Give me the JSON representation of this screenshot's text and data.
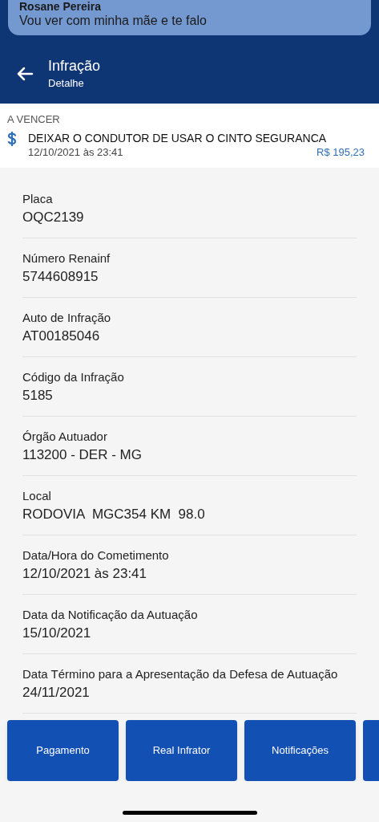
{
  "notification": {
    "sender": "Rosane Pereira",
    "message": "Vou ver com minha mãe e te falo"
  },
  "header": {
    "title": "Infração",
    "subtitle": "Detalhe"
  },
  "summary": {
    "status": "A VENCER",
    "description": "DEIXAR O CONDUTOR DE USAR O CINTO SEGURANCA",
    "datetime": "12/10/2021 às 23:41",
    "amount": "R$ 195,23"
  },
  "details": [
    {
      "label": "Placa",
      "value": "OQC2139"
    },
    {
      "label": "Número Renainf",
      "value": "5744608915"
    },
    {
      "label": "Auto de Infração",
      "value": "AT00185046"
    },
    {
      "label": "Código da Infração",
      "value": "5185"
    },
    {
      "label": "Órgão Autuador",
      "value": "113200 - DER - MG"
    },
    {
      "label": "Local",
      "value": "RODOVIA  MGC354 KM  98.0"
    },
    {
      "label": "Data/Hora do Cometimento",
      "value": "12/10/2021 às 23:41"
    },
    {
      "label": "Data da Notificação da Autuação",
      "value": "15/10/2021"
    },
    {
      "label": "Data Término para a Apresentação da Defesa de Autuação",
      "value": "24/11/2021"
    }
  ],
  "actions": [
    "Pagamento",
    "Real Infrator",
    "Notificações"
  ]
}
